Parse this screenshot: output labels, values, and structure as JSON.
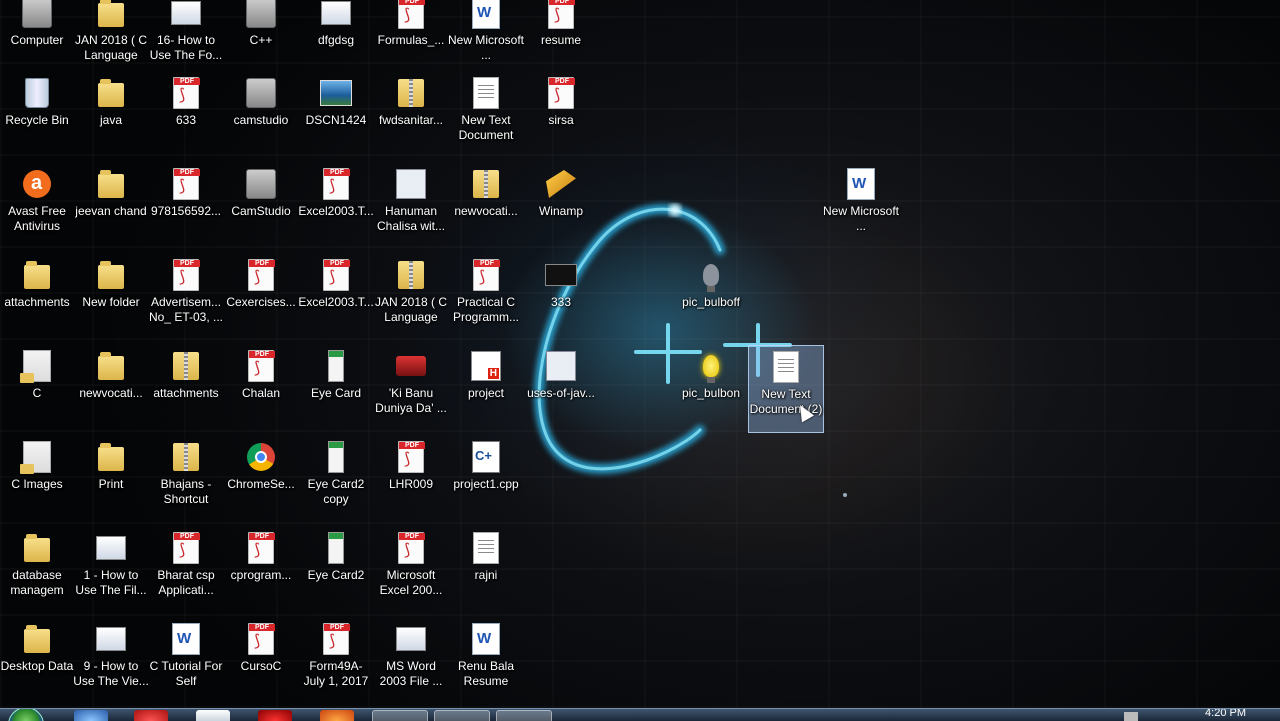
{
  "desktop": {
    "icons": [
      {
        "label": "Computer",
        "type": "app"
      },
      {
        "label": "JAN 2018 ( C Language",
        "type": "folder"
      },
      {
        "label": "16- How to Use The Fo...",
        "type": "screen"
      },
      {
        "label": "C++",
        "type": "app"
      },
      {
        "label": "dfgdsg",
        "type": "screen"
      },
      {
        "label": "Formulas_...",
        "type": "pdf"
      },
      {
        "label": "New Microsoft ...",
        "type": "word"
      },
      {
        "label": "resume",
        "type": "pdf"
      },
      {
        "label": "Recycle Bin",
        "type": "recycle"
      },
      {
        "label": "java",
        "type": "folder"
      },
      {
        "label": "633",
        "type": "pdf"
      },
      {
        "label": "camstudio",
        "type": "app"
      },
      {
        "label": "DSCN1424",
        "type": "image"
      },
      {
        "label": "fwdsanitar...",
        "type": "zip"
      },
      {
        "label": "New Text Document",
        "type": "doc"
      },
      {
        "label": "sirsa",
        "type": "pdf"
      },
      {
        "label": "Avast Free Antivirus",
        "type": "avast"
      },
      {
        "label": "jeevan chand",
        "type": "folder"
      },
      {
        "label": "978156592...",
        "type": "pdf"
      },
      {
        "label": "CamStudio",
        "type": "app"
      },
      {
        "label": "Excel2003.T...",
        "type": "pdf"
      },
      {
        "label": "Hanuman Chalisa wit...",
        "type": "logo"
      },
      {
        "label": "newvocati...",
        "type": "zip"
      },
      {
        "label": "Winamp",
        "type": "winamp"
      },
      {
        "label": "New Microsoft ...",
        "type": "word"
      },
      {
        "label": "attachments",
        "type": "folder"
      },
      {
        "label": "New folder",
        "type": "folder"
      },
      {
        "label": "Advertisem... No_ ET-03, ...",
        "type": "pdf"
      },
      {
        "label": "Cexercises...",
        "type": "pdf"
      },
      {
        "label": "Excel2003.T...",
        "type": "pdf"
      },
      {
        "label": "JAN 2018 ( C Language",
        "type": "zip"
      },
      {
        "label": "Practical C Programm...",
        "type": "pdf"
      },
      {
        "label": "333",
        "type": "video"
      },
      {
        "label": "pic_bulboff",
        "type": "bulb"
      },
      {
        "label": "C",
        "type": "folder-doc"
      },
      {
        "label": "newvocati...",
        "type": "folder"
      },
      {
        "label": "attachments",
        "type": "zip"
      },
      {
        "label": "Chalan",
        "type": "pdf"
      },
      {
        "label": "Eye Card",
        "type": "card"
      },
      {
        "label": "'Ki Banu Duniya Da' ...",
        "type": "red-app"
      },
      {
        "label": "project",
        "type": "project"
      },
      {
        "label": "uses-of-jav...",
        "type": "logo"
      },
      {
        "label": "pic_bulbon",
        "type": "bulb-on"
      },
      {
        "label": "New Text Document (2)",
        "type": "doc",
        "selected": true
      },
      {
        "label": "C Images",
        "type": "folder-doc"
      },
      {
        "label": "Print",
        "type": "folder"
      },
      {
        "label": "Bhajans - Shortcut",
        "type": "zip"
      },
      {
        "label": "ChromeSe...",
        "type": "chrome"
      },
      {
        "label": "Eye Card2 copy",
        "type": "card"
      },
      {
        "label": "LHR009",
        "type": "pdf"
      },
      {
        "label": "project1.cpp",
        "type": "cpp"
      },
      {
        "label": "database managem",
        "type": "folder"
      },
      {
        "label": "1 - How to Use The Fil...",
        "type": "screen"
      },
      {
        "label": "Bharat csp Applicati...",
        "type": "pdf"
      },
      {
        "label": "cprogram...",
        "type": "pdf"
      },
      {
        "label": "Eye Card2",
        "type": "card"
      },
      {
        "label": "Microsoft Excel 200...",
        "type": "pdf"
      },
      {
        "label": "rajni",
        "type": "doc"
      },
      {
        "label": "Desktop Data",
        "type": "folder"
      },
      {
        "label": "9 - How to Use The Vie...",
        "type": "screen"
      },
      {
        "label": "C Tutorial For Self",
        "type": "word"
      },
      {
        "label": "CursoC",
        "type": "pdf"
      },
      {
        "label": "Form49A- July 1, 2017",
        "type": "pdf"
      },
      {
        "label": "MS Word 2003 File ...",
        "type": "screen"
      },
      {
        "label": "Renu Bala Resume",
        "type": "word"
      }
    ]
  },
  "taskbar": {
    "clock": "4:20 PM",
    "buttons": [
      "start-orb",
      "ie-icon",
      "chrome-icon",
      "word-icon",
      "opera-icon",
      "firefox-icon",
      "explorer-icon",
      "camstudio-icon",
      "window-icon"
    ]
  }
}
